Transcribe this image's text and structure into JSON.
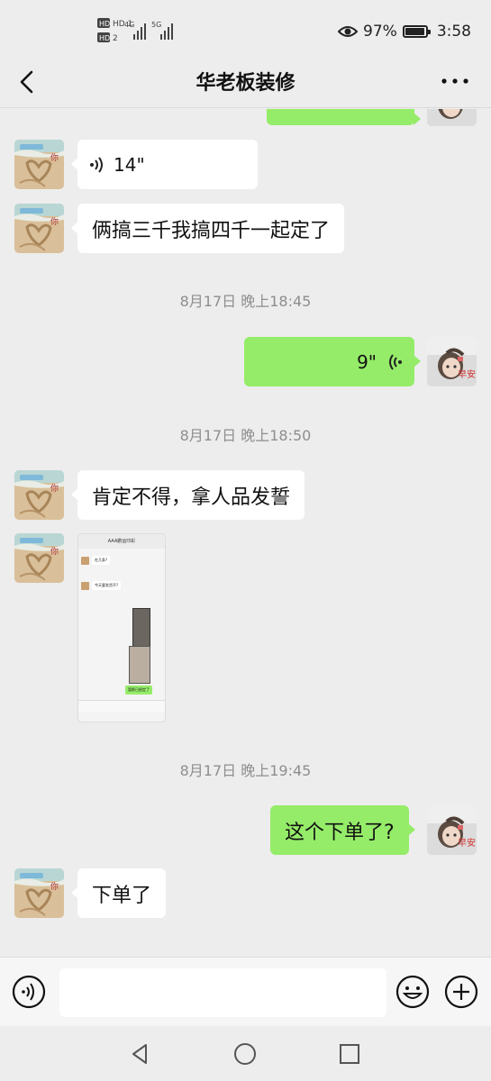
{
  "status_bar": {
    "sim1_label": "HD 1",
    "sim2_label": "HD 2",
    "network_1": "4G",
    "network_2": "5G",
    "battery_percent": "97%",
    "battery_level": 0.97,
    "time": "3:58",
    "icons": [
      "eye-comfort-icon",
      "signal-icon",
      "battery-icon"
    ]
  },
  "header": {
    "title": "华老板装修",
    "back_icon": "chevron-left-icon",
    "more_icon": "more-dots-icon"
  },
  "messages": [
    {
      "side": "in",
      "type": "voice",
      "text": "14\""
    },
    {
      "side": "in",
      "type": "text",
      "text": "俩搞三千我搞四千一起定了"
    },
    {
      "side": "time",
      "text": "8月17日 晚上18:45"
    },
    {
      "side": "out",
      "type": "voice",
      "text": "9\""
    },
    {
      "side": "time",
      "text": "8月17日 晚上18:50"
    },
    {
      "side": "in",
      "type": "text",
      "text": "肯定不得，拿人品发誓"
    },
    {
      "side": "in",
      "type": "image",
      "text": ""
    },
    {
      "side": "time",
      "text": "8月17日 晚上19:45"
    },
    {
      "side": "out",
      "type": "text",
      "text": "这个下单了?"
    },
    {
      "side": "in",
      "type": "text",
      "text": "下单了"
    }
  ],
  "screenshot_thumbnail": {
    "title": "AAA鹏运印彩",
    "line1": "在几条?",
    "line2": "今天要发货不?",
    "line3": "暂那已经定了"
  },
  "avatars": {
    "contact_caption": "你",
    "self_caption": "早安"
  },
  "input_bar": {
    "placeholder": "",
    "voice_icon": "voice-input-icon",
    "emoji_icon": "emoji-icon",
    "plus_icon": "plus-icon"
  },
  "system_nav": {
    "icons": [
      "back-triangle-icon",
      "home-circle-icon",
      "recents-square-icon"
    ]
  },
  "colors": {
    "background": "#ededed",
    "incoming_bubble": "#ffffff",
    "outgoing_bubble": "#95ec69",
    "timestamp": "#8e8e8e"
  }
}
